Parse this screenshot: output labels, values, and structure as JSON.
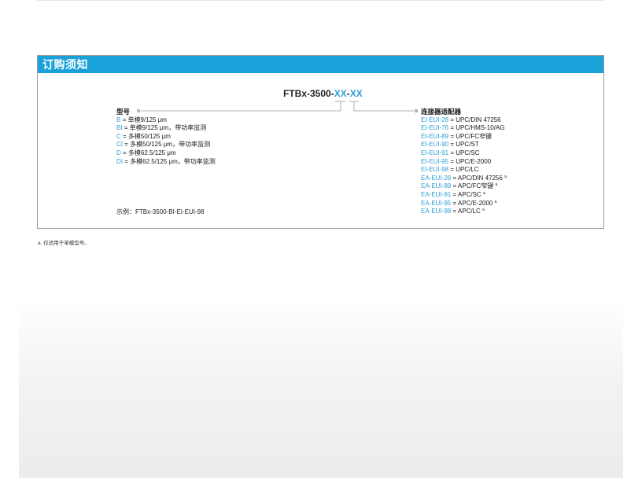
{
  "panel": {
    "title": "订购须知",
    "code_prefix": "FTBx-3500-",
    "code_var1": "XX",
    "code_sep": "-",
    "code_var2": "XX"
  },
  "model": {
    "heading": "型号",
    "items": [
      {
        "code": "B",
        "desc": " = 单模9/125 μm"
      },
      {
        "code": "BI",
        "desc": " = 单模9/125 μm，带功率监测"
      },
      {
        "code": "C",
        "desc": " = 多模50/125 μm"
      },
      {
        "code": "CI",
        "desc": " = 多模50/125 μm，带功率监测"
      },
      {
        "code": "D",
        "desc": " = 多模62.5/125 μm"
      },
      {
        "code": "DI",
        "desc": " = 多模62.5/125 μm，带功率监测"
      }
    ]
  },
  "connector": {
    "heading": "连接器适配器",
    "items": [
      {
        "code": "EI-EUI-28",
        "desc": " = UPC/DIN 47256",
        "note": ""
      },
      {
        "code": "EI-EUI-76",
        "desc": " = UPC/HMS-10/AG",
        "note": ""
      },
      {
        "code": "EI-EUI-89",
        "desc": " = UPC/FC窄键",
        "note": ""
      },
      {
        "code": "EI-EUI-90",
        "desc": " = UPC/ST",
        "note": ""
      },
      {
        "code": "EI-EUI-91",
        "desc": " = UPC/SC",
        "note": ""
      },
      {
        "code": "EI-EUI-95",
        "desc": " = UPC/E-2000",
        "note": ""
      },
      {
        "code": "EI-EUI-98",
        "desc": " = UPC/LC",
        "note": ""
      },
      {
        "code": "EA-EUI-28",
        "desc": " = APC/DIN 47256",
        "note": "a"
      },
      {
        "code": "EA-EUI-89",
        "desc": " = APC/FC窄键",
        "note": "a"
      },
      {
        "code": "EA-EUI-91",
        "desc": " = APC/SC",
        "note": "a"
      },
      {
        "code": "EA-EUI-95",
        "desc": " = APC/E-2000",
        "note": "a"
      },
      {
        "code": "EA-EUI-98",
        "desc": " = APC/LC",
        "note": "a"
      }
    ]
  },
  "example": "示例：FTBx-3500-BI-EI-EUI-98",
  "footnote": "a. 仅适用于单模型号。",
  "colors": {
    "header": "#1aa1da",
    "code": "#2e9fd6"
  }
}
